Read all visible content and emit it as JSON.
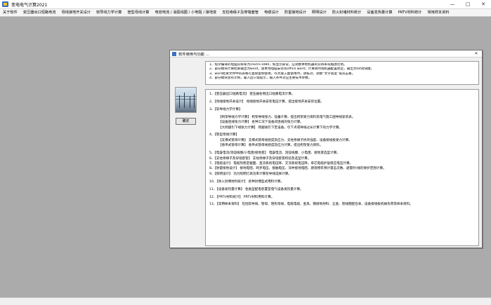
{
  "window": {
    "title": "变电电气计算2021",
    "controls": {
      "minimize": "—",
      "maximize": "□",
      "close": "✕"
    }
  },
  "menu": [
    "关于软件",
    "变压器出口短路电流",
    "母线接地开关设计",
    "软导线力学计算",
    "管型母线计算",
    "电容电流 / 消弧线圈 / 小电阻 / 接地变",
    "支柱绝缘子及穿墙套管",
    "电缆设计",
    "防雷接地设计",
    "照明设计",
    "防火封堵材料统计",
    "设备发热量计算",
    "PRTV材料统计",
    "常用样本资料"
  ],
  "dialog": {
    "title": "软件使用与功能 ...",
    "close": "✕",
    "ok_label": "确定",
    "notes": [
      "1、程序编译的电脑分辨率为1920×1080，如显示异常，应调整本地机器的分辨率或缩放比例。",
      "2、部分模块计算结果输出为word，需本地电脑安装有office word；计算耗时视机器配置而定，输出为txt则快捷。",
      "3、word结果文件中的表格可直接复制使用，作为施工图使用时，请核对，调整“文字高度”再双击看。",
      "4、部分模块含有示例，输入后只需提示，输入条件对应主要技术参数。"
    ],
    "items": [
      {
        "text": "1、【变压器出口短路电流】   变压器各侧出口短路电流计算。",
        "sub": false,
        "gap": false
      },
      {
        "text": "2、【母线接地开关设计】   母线接地开关安装电压计算，提出接地开关安装位置。",
        "sub": false,
        "gap": true
      },
      {
        "text": "3、【软导线力学计算】",
        "sub": false,
        "gap": true
      },
      {
        "text": "【构架导线力学计算】   构架导线张力、弧垂计算，提出构架受力资料及电气施工图导线安装表。",
        "sub": true,
        "gap": true
      },
      {
        "text": "【设备连线张力计算】   各种工况下设备间连线的张力计算。",
        "sub": true,
        "gap": false
      },
      {
        "text": "【大跨越引下线张力计算】   跨越线引下至设备，引下点或导线过长计算下的力学计算。",
        "sub": true,
        "gap": false
      },
      {
        "text": "4、【管型母线计算】",
        "sub": false,
        "gap": true
      },
      {
        "text": "【支撑式管母计算】   支撑式管母线挠度及应力、支柱绝缘子抗弯强度、设备接线板受力计算。",
        "sub": true,
        "gap": false
      },
      {
        "text": "【悬吊式管母计算】   悬吊式管母线挠度及应力计算，提出构架受力资料。",
        "sub": true,
        "gap": false
      },
      {
        "text": "5、【电容电流/消弧线圈/小电阻/接地变】   电容电流、消弧线圈、小电阻、接地变选型计算。",
        "sub": false,
        "gap": true
      },
      {
        "text": "6、【支柱绝缘子及穿墙套管】   支柱绝缘子及穿墙套管校验及选型计算。",
        "sub": false,
        "gap": false
      },
      {
        "text": "7、【电缆设计】   电缆热稳定截面、直流系统电压降、交流系统电压降，单芯电缆护层感应电压计算。",
        "sub": false,
        "gap": false
      },
      {
        "text": "8、【防雷接地设计】   接地电阻、跨步电压、接触电压、深井接地电阻、建筑物年预计雷击次数、避雷针/线的保护范围计算。",
        "sub": false,
        "gap": false
      },
      {
        "text": "9、【照明设计】   功力照明灯具功率计算及导线选择计算。",
        "sub": false,
        "gap": false
      },
      {
        "text": "10、【防火封堵材料统计】   各种封堵型式用料计算。",
        "sub": false,
        "gap": true
      },
      {
        "text": "11、【设备发热量计算】   各类型配电装置室电气设备发热量计算。",
        "sub": false,
        "gap": true
      },
      {
        "text": "12、【PRTV材料统计】   PRTV材料用料计算。",
        "sub": false,
        "gap": true
      },
      {
        "text": "13、【常用样本资料】   包括软导线、管母、矩形母线、电缆电缆、金具、钢接地材料、五金、管线圈配合表、设备接线板机械负荷等样本资料。",
        "sub": false,
        "gap": true
      }
    ]
  }
}
